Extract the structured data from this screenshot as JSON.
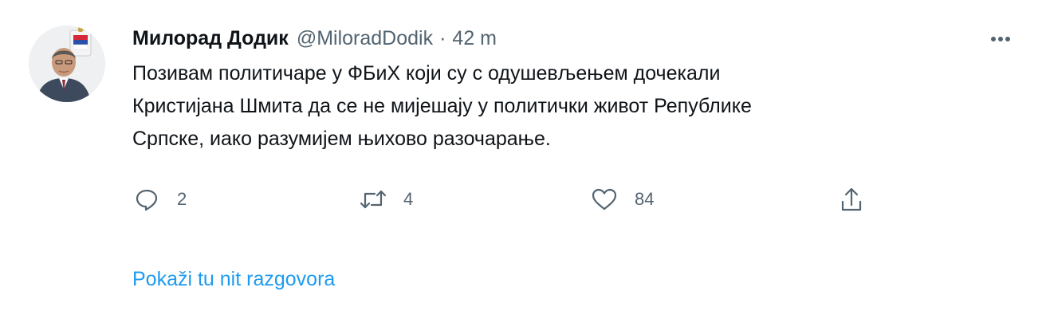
{
  "tweet": {
    "display_name": "Милорад Додик",
    "handle": "@MiloradDodik",
    "separator": "·",
    "time": "42 m",
    "text_lines": [
      "Позивам политичаре у ФБиХ који су с одушевљењем дочекали",
      "Кристијана Шмита да се не мијешају у политички живот Републике",
      "Српске, иако разумијем њихово разочарање."
    ]
  },
  "actions": {
    "reply": {
      "icon": "reply-icon",
      "count": "2"
    },
    "retweet": {
      "icon": "retweet-icon",
      "count": "4"
    },
    "like": {
      "icon": "heart-icon",
      "count": "84"
    },
    "share": {
      "icon": "share-icon"
    }
  },
  "thread_link": "Pokaži tu nit razgovora",
  "colors": {
    "text": "#0f1419",
    "secondary": "#536471",
    "link": "#1d9bf0"
  }
}
